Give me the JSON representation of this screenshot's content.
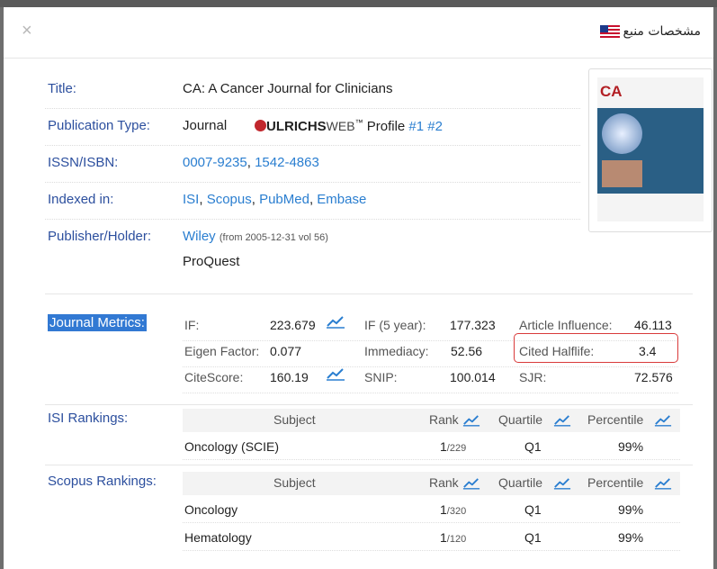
{
  "dialog": {
    "title": "مشخصات منبع",
    "close_glyph": "×"
  },
  "journal": {
    "labels": {
      "title": "Title:",
      "pubtype": "Publication Type:",
      "issn": "ISSN/ISBN:",
      "indexed": "Indexed in:",
      "publisher": "Publisher/Holder:"
    },
    "title": "CA: A Cancer Journal for Clinicians",
    "pubtype": "Journal",
    "ulrichs": {
      "brand": "ULRICHS",
      "web": "WEB",
      "tm": "™",
      "profile": " Profile",
      "link1": "#1",
      "link2": "#2"
    },
    "issn1": "0007-9235",
    "issn_sep": ",",
    "issn2": "1542-4863",
    "indexed": [
      "ISI",
      "Scopus",
      "PubMed",
      "Embase"
    ],
    "publisher": "Wiley",
    "publisher_note": "(from 2005-12-31 vol 56)",
    "publisher2": "ProQuest"
  },
  "cover": {
    "title": "CA"
  },
  "metrics": {
    "label": "Journal Metrics:",
    "if_label": "IF:",
    "if_value": "223.679",
    "if5_label": "IF (5 year):",
    "if5_value": "177.323",
    "ai_label": "Article Influence:",
    "ai_value": "46.113",
    "ef_label": "Eigen Factor:",
    "ef_value": "0.077",
    "imm_label": "Immediacy:",
    "imm_value": "52.56",
    "ch_label": "Cited Halflife:",
    "ch_value": "3.4",
    "cs_label": "CiteScore:",
    "cs_value": "160.19",
    "snip_label": "SNIP:",
    "snip_value": "100.014",
    "sjr_label": "SJR:",
    "sjr_value": "72.576"
  },
  "rankings": {
    "headers": {
      "subject": "Subject",
      "rank": "Rank",
      "quartile": "Quartile",
      "percentile": "Percentile"
    },
    "isi": {
      "label": "ISI Rankings:",
      "rows": [
        {
          "subject": "Oncology (SCIE)",
          "rank": "1",
          "total": "/229",
          "quartile": "Q1",
          "percentile": "99%"
        }
      ]
    },
    "scopus": {
      "label": "Scopus Rankings:",
      "rows": [
        {
          "subject": "Oncology",
          "rank": "1",
          "total": "/320",
          "quartile": "Q1",
          "percentile": "99%"
        },
        {
          "subject": "Hematology",
          "rank": "1",
          "total": "/120",
          "quartile": "Q1",
          "percentile": "99%"
        }
      ]
    }
  },
  "colors": {
    "link": "#2a7ed0",
    "label": "#2c4f9e",
    "highlight": "#3279d3",
    "box": "#d93a3a",
    "ulrichs_red": "#c1272d"
  },
  "icons": [
    "close-icon",
    "us-flag-icon",
    "trend-chart-icon"
  ]
}
